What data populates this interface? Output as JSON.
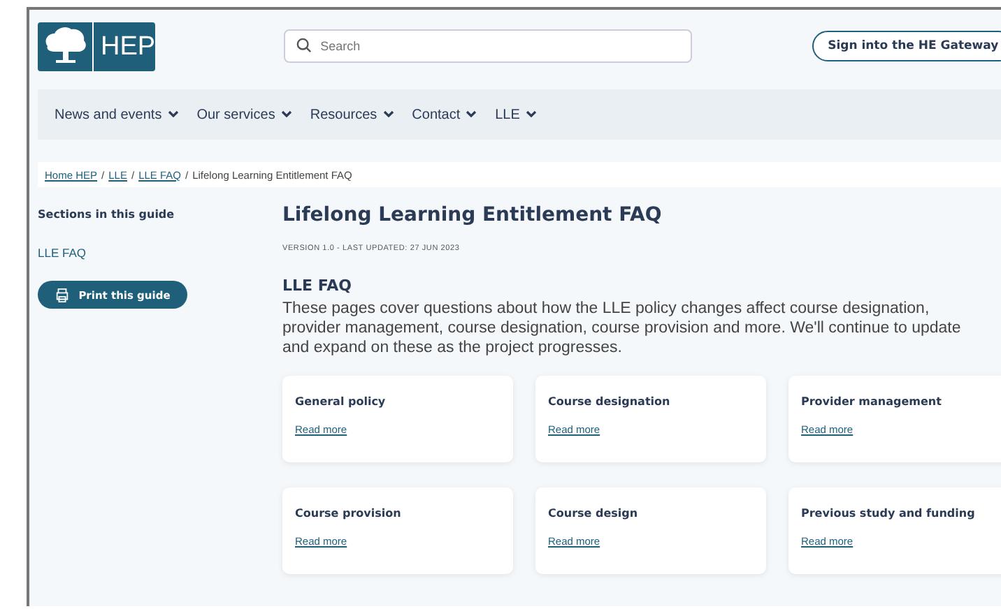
{
  "logo": {
    "text": "HEP"
  },
  "search": {
    "placeholder": "Search"
  },
  "sign_in_button": "Sign into the HE Gateway",
  "nav": [
    {
      "label": "News and events"
    },
    {
      "label": "Our services"
    },
    {
      "label": "Resources"
    },
    {
      "label": "Contact"
    },
    {
      "label": "LLE"
    }
  ],
  "breadcrumb": {
    "links": [
      "Home HEP",
      "LLE",
      "LLE FAQ"
    ],
    "separator": "/",
    "current": "Lifelong Learning Entitlement FAQ"
  },
  "sidebar": {
    "title": "Sections in this guide",
    "items": [
      "LLE FAQ"
    ],
    "print_button": "Print this guide"
  },
  "main": {
    "title": "Lifelong Learning Entitlement FAQ",
    "version": "VERSION 1.0 - LAST UPDATED: 27 JUN 2023",
    "section_title": "LLE FAQ",
    "intro": "These pages cover questions about how the LLE policy changes affect course designation, provider management, course designation, course provision and more. We'll continue to update and expand on these as the project progresses.",
    "cards": [
      {
        "title": "General policy",
        "link": "Read more"
      },
      {
        "title": "Course designation",
        "link": "Read more"
      },
      {
        "title": "Provider management",
        "link": "Read more"
      },
      {
        "title": "Course provision",
        "link": "Read more"
      },
      {
        "title": "Course design",
        "link": "Read more"
      },
      {
        "title": "Previous study and funding",
        "link": "Read more"
      }
    ]
  }
}
